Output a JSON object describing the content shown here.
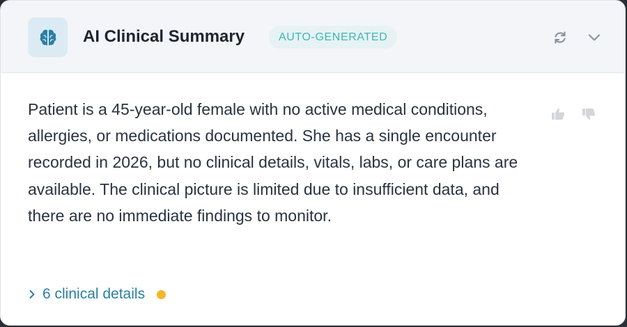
{
  "card": {
    "title": "AI Clinical Summary",
    "badge": "AUTO-GENERATED",
    "header_icons": {
      "brand": "brain-icon",
      "refresh": "refresh-icon",
      "collapse": "chevron-down-icon"
    }
  },
  "summary": {
    "text": "Patient is a 45-year-old female with no active medical conditions, allergies, or medications documented. She has a single encounter recorded in 2026, but no clinical details, vitals, labs, or care plans are available. The clinical picture is limited due to insufficient data, and there are no immediate findings to monitor."
  },
  "feedback": {
    "up_icon": "thumbs-up-icon",
    "down_icon": "thumbs-down-icon"
  },
  "details": {
    "label": "6 clinical details",
    "icon": "chevron-right-icon"
  },
  "colors": {
    "accent": "#2b7fa3",
    "badge_text": "#3fb6b8",
    "badge_bg": "#e6f2f4",
    "brain": "#2b7fa3",
    "status_dot": "#f3b72a"
  }
}
